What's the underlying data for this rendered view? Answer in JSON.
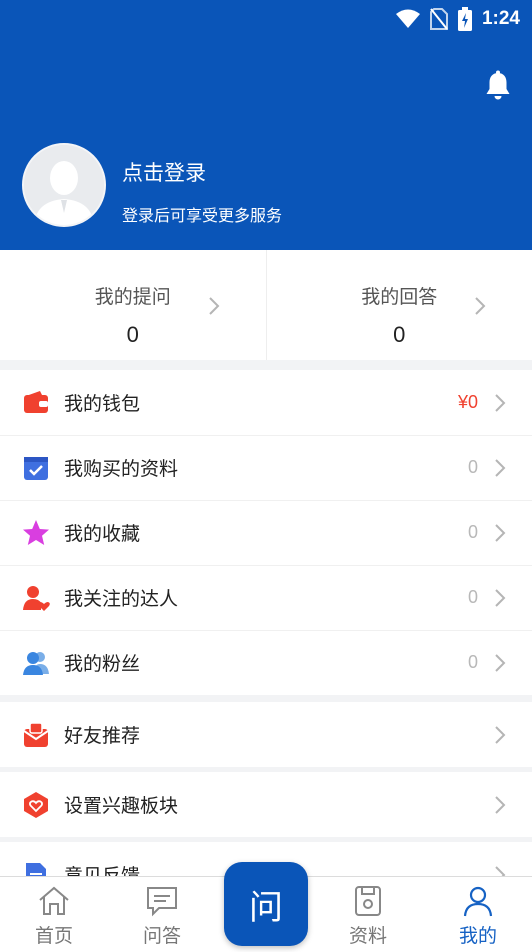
{
  "status_bar": {
    "time": "1:24"
  },
  "profile": {
    "title": "点击登录",
    "subtitle": "登录后可享受更多服务"
  },
  "stats": [
    {
      "label": "我的提问",
      "value": "0"
    },
    {
      "label": "我的回答",
      "value": "0"
    }
  ],
  "menu_group_1": [
    {
      "label": "我的钱包",
      "value": "¥0",
      "icon": "wallet-icon"
    },
    {
      "label": "我购买的资料",
      "value": "0",
      "icon": "purchased-materials-icon"
    },
    {
      "label": "我的收藏",
      "value": "0",
      "icon": "star-icon"
    },
    {
      "label": "我关注的达人",
      "value": "0",
      "icon": "followed-user-icon"
    },
    {
      "label": "我的粉丝",
      "value": "0",
      "icon": "fans-icon"
    }
  ],
  "menu_group_2": [
    {
      "label": "好友推荐",
      "icon": "recommend-friend-icon"
    }
  ],
  "menu_group_3": [
    {
      "label": "设置兴趣板块",
      "icon": "interest-settings-icon"
    }
  ],
  "menu_group_4": [
    {
      "label": "意见反馈",
      "icon": "feedback-icon"
    }
  ],
  "tabbar": {
    "home": "首页",
    "qa": "问答",
    "ask": "问",
    "materials": "资料",
    "mine": "我的"
  },
  "colors": {
    "brand": "#0a55b8",
    "active_tab": "#1662c4",
    "money": "#f0412f"
  }
}
